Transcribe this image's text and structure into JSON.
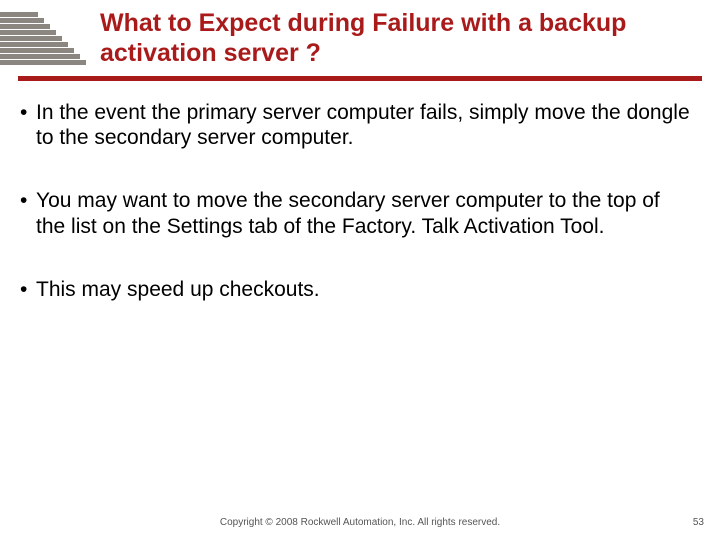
{
  "title": "What to Expect during Failure with a backup activation server ?",
  "bullets": [
    "In the event the primary server computer fails, simply move the dongle to the secondary server computer.",
    "You may want to move the secondary server computer to the top of the list on the Settings tab of the Factory. Talk Activation Tool.",
    "This may speed up checkouts."
  ],
  "footer": "Copyright © 2008 Rockwell Automation, Inc. All rights reserved.",
  "page_number": "53"
}
